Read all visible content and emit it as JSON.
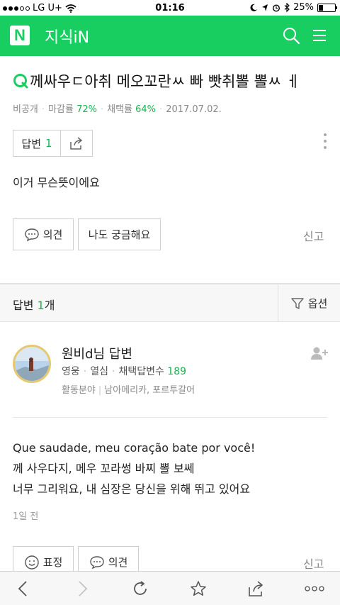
{
  "status_bar": {
    "carrier": "LG U+",
    "time": "01:16",
    "battery": "25%",
    "battery_level": 0.25
  },
  "header": {
    "logo": "N",
    "title": "지식iN"
  },
  "question": {
    "title": "께싸우ㄷ아취 메오꼬란ㅆ 빠 빳취뽈 뽈ㅆ ㅔ",
    "meta": {
      "visibility": "비공개",
      "deadline_label": "마감률",
      "deadline_value": "72%",
      "adopt_label": "채택률",
      "adopt_value": "64%",
      "date": "2017.07.02."
    },
    "answer_button_label": "답변",
    "answer_button_count": "1",
    "body": "이거 무슨뜻이에요",
    "opinion_label": "의견",
    "curious_label": "나도 궁금해요",
    "report_label": "신고"
  },
  "answers_bar": {
    "label_prefix": "답변",
    "count": "1",
    "label_suffix": "개",
    "option_label": "옵션"
  },
  "answer": {
    "author": "원비d님 답변",
    "grade": "영웅",
    "activity": "열심",
    "adopted_label": "채택답변수",
    "adopted_count": "189",
    "field_label": "활동분야",
    "field_value": "남아메리카, 포르투갈어",
    "lines": [
      "Que saudade, meu coração bate por você!",
      "께 사우다지, 메우 꼬라썽 바찌 뽈 보쎄",
      "너무 그리워요, 내 심장은 당신을 위해 뛰고 있어요"
    ],
    "time": "1일 전",
    "expression_label": "표정",
    "opinion_label": "의견",
    "report_label": "신고"
  },
  "colors": {
    "brand": "#19ce60",
    "accent_text": "#19b453"
  }
}
